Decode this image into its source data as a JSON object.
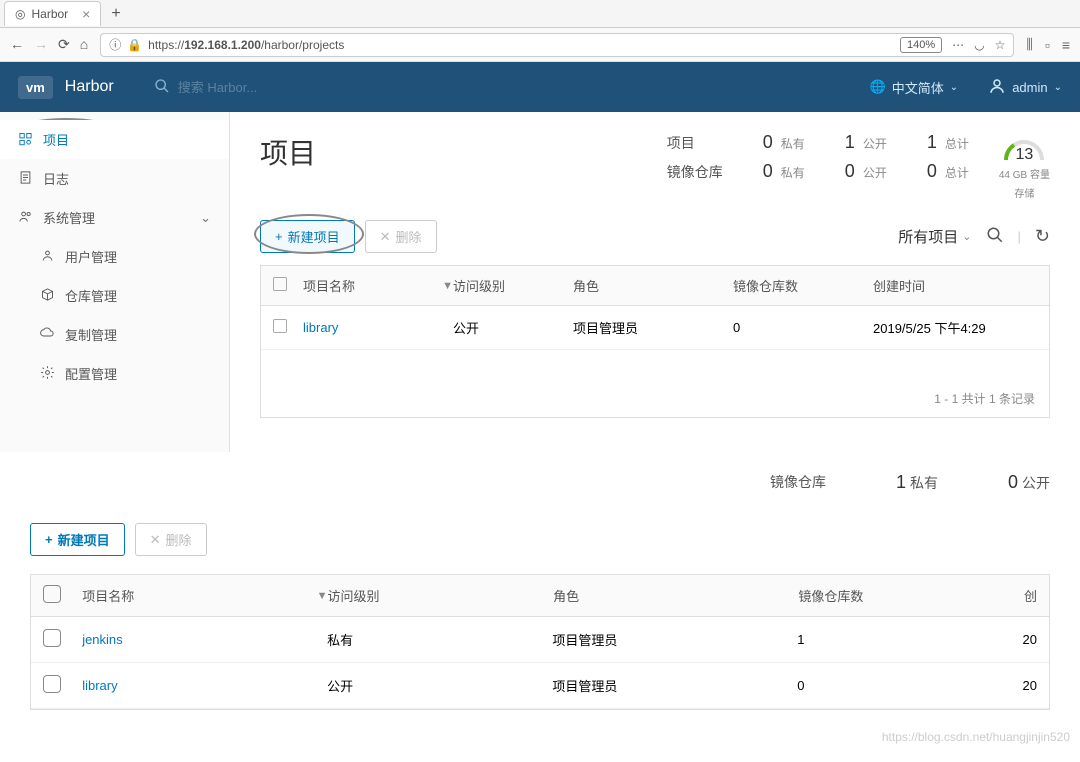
{
  "browser": {
    "tab_title": "Harbor",
    "url_display": "https://192.168.1.200/harbor/projects",
    "url_host": "192.168.1.200",
    "zoom": "140%"
  },
  "header": {
    "logo": "vm",
    "app_name": "Harbor",
    "search_placeholder": "搜索 Harbor...",
    "language": "中文简体",
    "user": "admin"
  },
  "sidebar": {
    "items": [
      {
        "label": "项目"
      },
      {
        "label": "日志"
      },
      {
        "label": "系统管理"
      },
      {
        "label": "用户管理"
      },
      {
        "label": "仓库管理"
      },
      {
        "label": "复制管理"
      },
      {
        "label": "配置管理"
      }
    ]
  },
  "page": {
    "title": "项目",
    "stat_labels": {
      "projects": "项目",
      "repos": "镜像仓库",
      "private": "私有",
      "public": "公开",
      "total": "总计"
    },
    "stats": {
      "projects": {
        "private": "0",
        "public": "1",
        "total": "1"
      },
      "repos": {
        "private": "0",
        "public": "0",
        "total": "0"
      }
    },
    "gauge": {
      "value": "13",
      "unit": "44 GB 容量",
      "label": "存储"
    }
  },
  "actions": {
    "new_project": "新建项目",
    "delete": "删除",
    "filter_all": "所有项目"
  },
  "table": {
    "headers": {
      "name": "项目名称",
      "access": "访问级别",
      "role": "角色",
      "repo_count": "镜像仓库数",
      "create_time": "创建时间"
    },
    "rows": [
      {
        "name": "library",
        "access": "公开",
        "role": "项目管理员",
        "repo_count": "0",
        "create_time": "2019/5/25 下午4:29"
      }
    ],
    "footer": "1 - 1 共计 1 条记录"
  },
  "section2": {
    "stats": {
      "repos_label": "镜像仓库",
      "private_n": "1",
      "private_l": "私有",
      "public_n": "0",
      "public_l": "公开"
    },
    "actions": {
      "new_project": "新建项目",
      "delete": "删除"
    },
    "headers": {
      "name": "项目名称",
      "access": "访问级别",
      "role": "角色",
      "repo_count": "镜像仓库数",
      "create_time": "创"
    },
    "rows": [
      {
        "name": "jenkins",
        "access": "私有",
        "role": "项目管理员",
        "repo_count": "1",
        "create_time": "20"
      },
      {
        "name": "library",
        "access": "公开",
        "role": "项目管理员",
        "repo_count": "0",
        "create_time": "20"
      }
    ]
  },
  "watermark": "https://blog.csdn.net/huangjinjin520"
}
